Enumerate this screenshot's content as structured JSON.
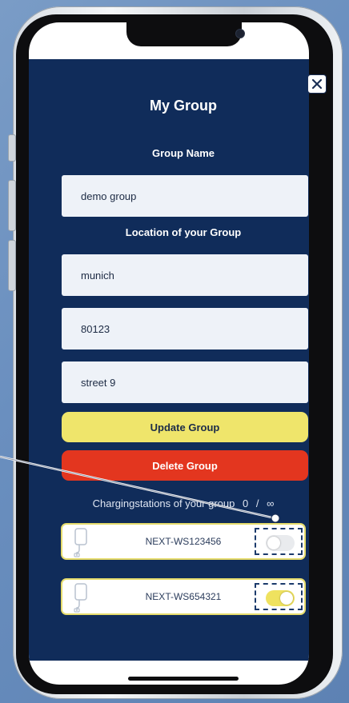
{
  "modal": {
    "title": "My Group",
    "group_name_label": "Group Name",
    "group_name_value": "demo group",
    "location_label": "Location of your Group",
    "city_value": "munich",
    "zip_value": "80123",
    "street_value": "street 9",
    "update_label": "Update Group",
    "delete_label": "Delete Group"
  },
  "stations": {
    "header": "Chargingstations of your group",
    "count": "0",
    "separator": "/",
    "limit": "∞",
    "items": [
      {
        "name": "NEXT-WS123456",
        "enabled": false
      },
      {
        "name": "NEXT-WS654321",
        "enabled": true
      }
    ]
  },
  "colors": {
    "app_background": "#102c5a",
    "accent_yellow": "#efe56b",
    "danger_red": "#e3361f"
  },
  "icons": [
    "close-icon",
    "charging-station-icon"
  ]
}
